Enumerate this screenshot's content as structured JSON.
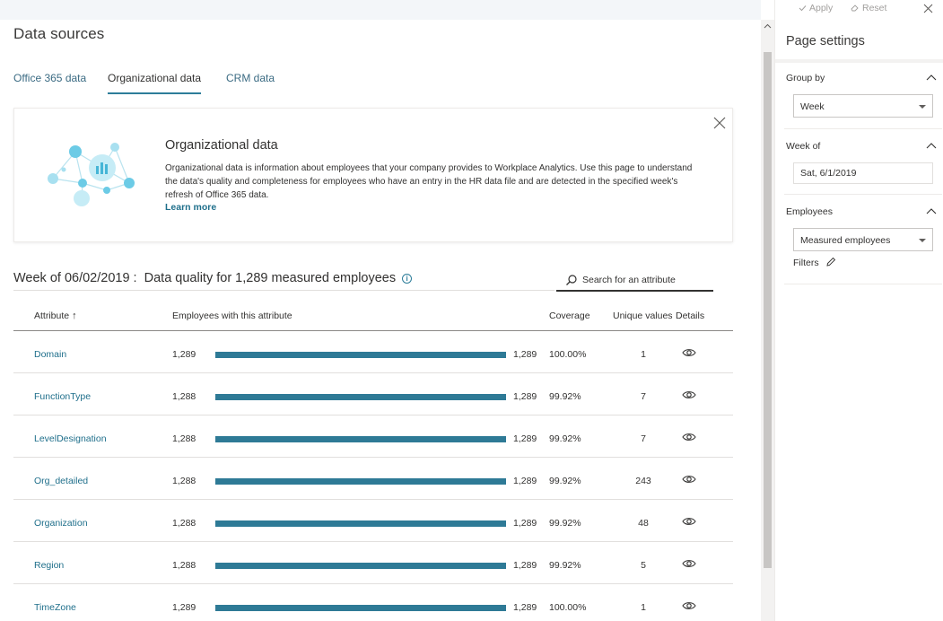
{
  "page": {
    "title": "Data sources"
  },
  "tabs": [
    {
      "label": "Office 365 data",
      "active": false
    },
    {
      "label": "Organizational data",
      "active": true
    },
    {
      "label": "CRM data",
      "active": false
    }
  ],
  "info_card": {
    "title": "Organizational data",
    "text": "Organizational data is information about employees that your company provides to Workplace Analytics. Use this page to understand the data's quality and completeness for employees who have an entry in the HR data file and are detected in the specified week's refresh of Office 365 data.",
    "link": "Learn more",
    "close_icon": "close-icon",
    "illustration": "network-chart-illustration"
  },
  "section": {
    "week_label": "Week of 06/02/2019 :",
    "quality_label": "Data quality for 1,289 measured employees",
    "info_icon": "i"
  },
  "search": {
    "placeholder": "Search for an attribute",
    "value": ""
  },
  "table": {
    "headers": {
      "attribute": "Attribute",
      "sort_arrow": "↑",
      "employees": "Employees with this attribute",
      "coverage": "Coverage",
      "unique": "Unique values",
      "details": "Details"
    },
    "rows": [
      {
        "attribute": "Domain",
        "employees": "1,289",
        "total": "1,289",
        "coverage": "100.00%",
        "unique": "1",
        "fill": 1.0
      },
      {
        "attribute": "FunctionType",
        "employees": "1,288",
        "total": "1,289",
        "coverage": "99.92%",
        "unique": "7",
        "fill": 0.9992
      },
      {
        "attribute": "LevelDesignation",
        "employees": "1,288",
        "total": "1,289",
        "coverage": "99.92%",
        "unique": "7",
        "fill": 0.9992
      },
      {
        "attribute": "Org_detailed",
        "employees": "1,288",
        "total": "1,289",
        "coverage": "99.92%",
        "unique": "243",
        "fill": 0.9992
      },
      {
        "attribute": "Organization",
        "employees": "1,288",
        "total": "1,289",
        "coverage": "99.92%",
        "unique": "48",
        "fill": 0.9992
      },
      {
        "attribute": "Region",
        "employees": "1,288",
        "total": "1,289",
        "coverage": "99.92%",
        "unique": "5",
        "fill": 0.9992
      },
      {
        "attribute": "TimeZone",
        "employees": "1,289",
        "total": "1,289",
        "coverage": "100.00%",
        "unique": "1",
        "fill": 1.0
      }
    ]
  },
  "panel": {
    "apply_label": "Apply",
    "reset_label": "Reset",
    "title": "Page settings",
    "group_by": {
      "label": "Group by",
      "selected": "Week"
    },
    "week_of": {
      "label": "Week of",
      "value": "Sat, 6/1/2019"
    },
    "employees": {
      "label": "Employees",
      "selected": "Measured employees"
    },
    "filters_label": "Filters"
  },
  "colors": {
    "accent": "#2e7a96",
    "link": "#1f6f8b",
    "text": "#323130"
  }
}
